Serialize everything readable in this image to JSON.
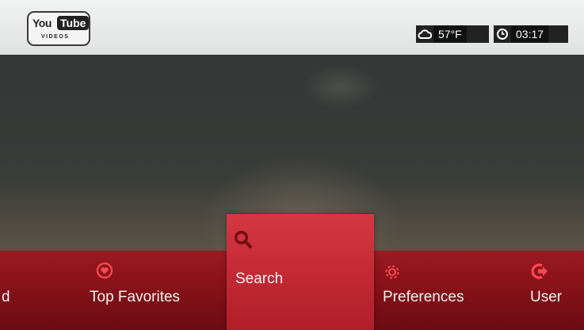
{
  "header": {
    "logo": {
      "word_you": "You",
      "word_tube": "Tube",
      "word_videos": "VIDEOS"
    },
    "weather": {
      "icon": "cloud-icon",
      "value": "57°F"
    },
    "clock": {
      "icon": "clock-icon",
      "value": "03:17"
    }
  },
  "menu": {
    "items": [
      {
        "label": "d",
        "icon": "none"
      },
      {
        "label": "Top Favorites",
        "icon": "heart-icon"
      },
      {
        "label": "Search",
        "icon": "search-icon",
        "selected": true
      },
      {
        "label": "Preferences",
        "icon": "gear-icon"
      },
      {
        "label": "User",
        "icon": "sign-in-icon"
      }
    ]
  },
  "colors": {
    "menu_bar": "#8a1219",
    "selected_tile": "#c42a35",
    "accent_icon": "#e0303c",
    "header_bg": "#e8ebea"
  }
}
